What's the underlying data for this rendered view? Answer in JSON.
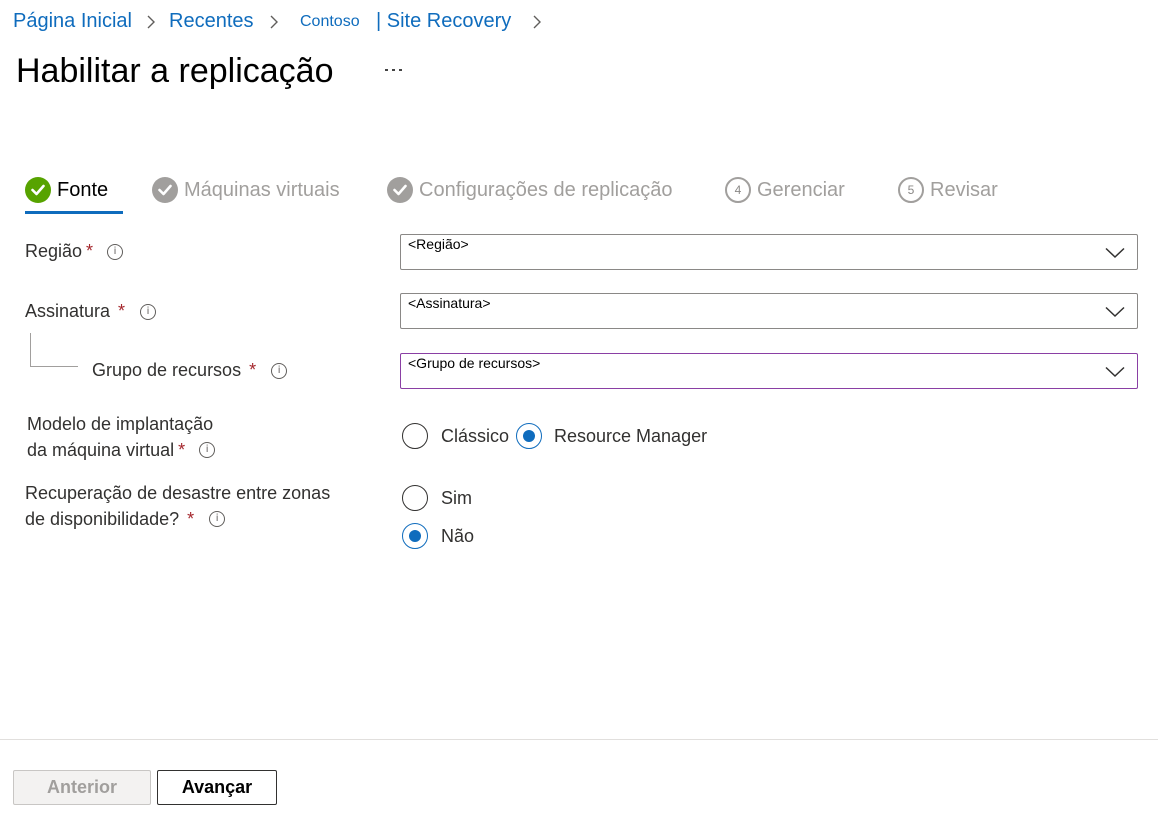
{
  "breadcrumb": {
    "items": [
      "Página Inicial",
      "Recentes",
      "Contoso",
      "| Site Recovery"
    ]
  },
  "page": {
    "title": "Habilitar a replicação",
    "more_label": "..."
  },
  "stepper": {
    "steps": [
      {
        "label": "Fonte",
        "state": "active",
        "icon": "check-circle-icon"
      },
      {
        "label": "Máquinas virtuais",
        "state": "done",
        "icon": "check-circle-icon"
      },
      {
        "label": "Configurações de replicação",
        "state": "done",
        "icon": "check-circle-icon"
      },
      {
        "label": "Gerenciar",
        "state": "todo",
        "number": "4"
      },
      {
        "label": "Revisar",
        "state": "todo",
        "number": "5"
      }
    ],
    "colors": {
      "active": "#57a300",
      "done": "#a19f9d",
      "accent": "#0f6cbd"
    }
  },
  "form": {
    "region": {
      "label": "Região",
      "required": "*",
      "value": "<Região>"
    },
    "subscription": {
      "label": "Assinatura",
      "required": "*",
      "value": "<Assinatura>"
    },
    "resource_group": {
      "label": "Grupo de recursos",
      "required": "*",
      "value": "<Grupo de recursos>"
    },
    "deployment_model": {
      "label_line1": "Modelo de implantação",
      "label_line2": "da máquina virtual",
      "required": "*",
      "options": [
        "Clássico",
        "Resource Manager"
      ],
      "selected": "Resource Manager"
    },
    "zone_dr": {
      "label_line1": "Recuperação de desastre entre zonas",
      "label_line2": "de disponibilidade?",
      "required": "*",
      "options": [
        "Sim",
        "Não"
      ],
      "selected": "Não"
    },
    "info_glyph": "i"
  },
  "footer": {
    "previous_label": "Anterior",
    "next_label": "Avançar"
  }
}
